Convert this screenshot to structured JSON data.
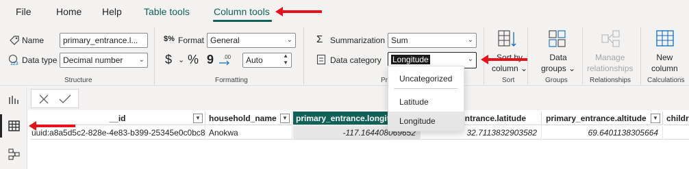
{
  "tabs": {
    "file": "File",
    "home": "Home",
    "help": "Help",
    "table_tools": "Table tools",
    "column_tools": "Column tools"
  },
  "structure": {
    "name_label": "Name",
    "name_value": "primary_entrance.l...",
    "data_type_label": "Data type",
    "data_type_value": "Decimal number",
    "group_label": "Structure"
  },
  "formatting": {
    "format_label": "Format",
    "format_value": "General",
    "currency_symbol": "$",
    "percent_symbol": "%",
    "comma_symbol": "9",
    "decimals_value": "Auto",
    "group_label": "Formatting"
  },
  "properties": {
    "summarization_label": "Summarization",
    "summarization_value": "Sum",
    "data_category_label": "Data category",
    "data_category_value": "Longitude",
    "group_label": "Pr"
  },
  "sort": {
    "button_line1": "Sort by",
    "button_line2": "column",
    "group_label": "Sort"
  },
  "groups": {
    "button_line1": "Data",
    "button_line2": "groups",
    "group_label": "Groups"
  },
  "relationships": {
    "button_line1": "Manage",
    "button_line2": "relationships",
    "group_label": "Relationships"
  },
  "calculations": {
    "button_line1": "New",
    "button_line2": "column",
    "group_label": "Calculations"
  },
  "data_category_menu": {
    "options": [
      "Uncategorized",
      "Latitude",
      "Longitude"
    ],
    "selected": "Longitude"
  },
  "table": {
    "columns": [
      "__id",
      "household_name",
      "primary_entrance.longitude",
      "primary_entrance.latitude",
      "primary_entrance.altitude",
      "childr"
    ],
    "selected_column": "primary_entrance.longitude",
    "rows": [
      [
        "uuid:a8a5d5c2-828e-4e83-b399-25345e0c0bc8",
        "Anokwa",
        "-117.164408069652",
        "32.7113832903582",
        "69.6401138305664",
        ""
      ]
    ]
  },
  "colors": {
    "accent": "#0f6158",
    "arrow": "#e8101a",
    "ribbon_bg": "#f3f2f1"
  }
}
